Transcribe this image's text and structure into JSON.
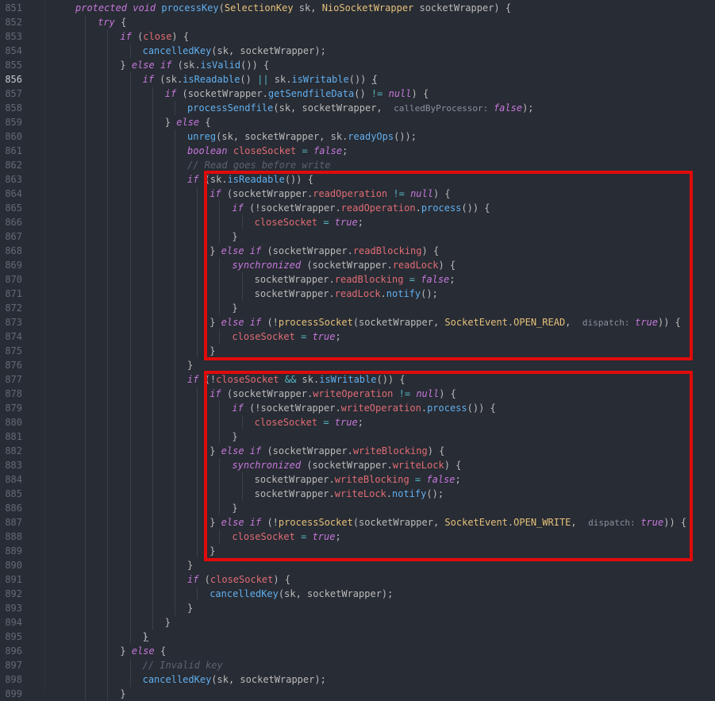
{
  "editor": {
    "current_line": "856",
    "highlights": [
      "if-readable-block",
      "if-writable-block"
    ],
    "colors": {
      "background": "#282c34",
      "highlight_box": "#e00b0b"
    },
    "lines": [
      {
        "n": "851",
        "indent": 4,
        "t": [
          [
            "kw",
            "protected void "
          ],
          [
            "fn",
            "processKey"
          ],
          [
            "txt",
            "("
          ],
          [
            "type",
            "SelectionKey"
          ],
          [
            "txt",
            " sk, "
          ],
          [
            "type",
            "NioSocketWrapper"
          ],
          [
            "txt",
            " socketWrapper) {"
          ]
        ]
      },
      {
        "n": "852",
        "indent": 5,
        "t": [
          [
            "kw",
            "try"
          ],
          [
            "txt",
            " {"
          ]
        ]
      },
      {
        "n": "853",
        "indent": 6,
        "t": [
          [
            "kw",
            "if"
          ],
          [
            "txt",
            " ("
          ],
          [
            "var",
            "close"
          ],
          [
            "txt",
            ") {"
          ]
        ]
      },
      {
        "n": "854",
        "indent": 7,
        "t": [
          [
            "fn",
            "cancelledKey"
          ],
          [
            "txt",
            "(sk, socketWrapper);"
          ]
        ]
      },
      {
        "n": "855",
        "indent": 6,
        "t": [
          [
            "txt",
            "} "
          ],
          [
            "kw",
            "else if"
          ],
          [
            "txt",
            " (sk."
          ],
          [
            "fn",
            "isValid"
          ],
          [
            "txt",
            "()) {"
          ]
        ]
      },
      {
        "n": "856",
        "indent": 7,
        "t": [
          [
            "kw",
            "if"
          ],
          [
            "txt",
            " (sk."
          ],
          [
            "fn",
            "isReadable"
          ],
          [
            "txt",
            "() "
          ],
          [
            "op",
            "||"
          ],
          [
            "txt",
            " sk."
          ],
          [
            "fn",
            "isWritable"
          ],
          [
            "txt",
            "()) "
          ],
          [
            "brace",
            "{"
          ]
        ]
      },
      {
        "n": "857",
        "indent": 8,
        "t": [
          [
            "kw",
            "if"
          ],
          [
            "txt",
            " (socketWrapper."
          ],
          [
            "fn",
            "getSendfileData"
          ],
          [
            "txt",
            "() "
          ],
          [
            "op",
            "!="
          ],
          [
            "txt",
            " "
          ],
          [
            "bool",
            "null"
          ],
          [
            "txt",
            ") {"
          ]
        ]
      },
      {
        "n": "858",
        "indent": 9,
        "t": [
          [
            "fn",
            "processSendfile"
          ],
          [
            "txt",
            "(sk, socketWrapper,  "
          ],
          [
            "hint",
            "calledByProcessor: "
          ],
          [
            "bool",
            "false"
          ],
          [
            "txt",
            ");"
          ]
        ]
      },
      {
        "n": "859",
        "indent": 8,
        "t": [
          [
            "txt",
            "} "
          ],
          [
            "kw",
            "else"
          ],
          [
            "txt",
            " {"
          ]
        ]
      },
      {
        "n": "860",
        "indent": 9,
        "t": [
          [
            "fn",
            "unreg"
          ],
          [
            "txt",
            "(sk, socketWrapper, sk."
          ],
          [
            "fn",
            "readyOps"
          ],
          [
            "txt",
            "());"
          ]
        ]
      },
      {
        "n": "861",
        "indent": 9,
        "t": [
          [
            "kw",
            "boolean"
          ],
          [
            "txt",
            " "
          ],
          [
            "var",
            "closeSocket"
          ],
          [
            "txt",
            " "
          ],
          [
            "op",
            "="
          ],
          [
            "txt",
            " "
          ],
          [
            "bool",
            "false"
          ],
          [
            "txt",
            ";"
          ]
        ]
      },
      {
        "n": "862",
        "indent": 9,
        "t": [
          [
            "cmt",
            "// Read goes before write"
          ]
        ]
      },
      {
        "n": "863",
        "indent": 9,
        "t": [
          [
            "kw",
            "if"
          ],
          [
            "txt",
            " (sk."
          ],
          [
            "fn",
            "isReadable"
          ],
          [
            "txt",
            "()) {"
          ]
        ]
      },
      {
        "n": "864",
        "indent": 10,
        "t": [
          [
            "kw",
            "if"
          ],
          [
            "txt",
            " (socketWrapper."
          ],
          [
            "field",
            "readOperation"
          ],
          [
            "txt",
            " "
          ],
          [
            "op",
            "!="
          ],
          [
            "txt",
            " "
          ],
          [
            "bool",
            "null"
          ],
          [
            "txt",
            ") {"
          ]
        ]
      },
      {
        "n": "865",
        "indent": 11,
        "t": [
          [
            "kw",
            "if"
          ],
          [
            "txt",
            " (!socketWrapper."
          ],
          [
            "field",
            "readOperation"
          ],
          [
            "txt",
            "."
          ],
          [
            "fn",
            "process"
          ],
          [
            "txt",
            "()) {"
          ]
        ]
      },
      {
        "n": "866",
        "indent": 12,
        "t": [
          [
            "var",
            "closeSocket"
          ],
          [
            "txt",
            " "
          ],
          [
            "op",
            "="
          ],
          [
            "txt",
            " "
          ],
          [
            "bool",
            "true"
          ],
          [
            "txt",
            ";"
          ]
        ]
      },
      {
        "n": "867",
        "indent": 11,
        "t": [
          [
            "txt",
            "}"
          ]
        ]
      },
      {
        "n": "868",
        "indent": 10,
        "t": [
          [
            "txt",
            "} "
          ],
          [
            "kw",
            "else if"
          ],
          [
            "txt",
            " (socketWrapper."
          ],
          [
            "field",
            "readBlocking"
          ],
          [
            "txt",
            ") {"
          ]
        ]
      },
      {
        "n": "869",
        "indent": 11,
        "t": [
          [
            "kw",
            "synchronized"
          ],
          [
            "txt",
            " (socketWrapper."
          ],
          [
            "field",
            "readLock"
          ],
          [
            "txt",
            ") {"
          ]
        ]
      },
      {
        "n": "870",
        "indent": 12,
        "t": [
          [
            "txt",
            "socketWrapper."
          ],
          [
            "field",
            "readBlocking"
          ],
          [
            "txt",
            " "
          ],
          [
            "op",
            "="
          ],
          [
            "txt",
            " "
          ],
          [
            "bool",
            "false"
          ],
          [
            "txt",
            ";"
          ]
        ]
      },
      {
        "n": "871",
        "indent": 12,
        "t": [
          [
            "txt",
            "socketWrapper."
          ],
          [
            "field",
            "readLock"
          ],
          [
            "txt",
            "."
          ],
          [
            "fn",
            "notify"
          ],
          [
            "txt",
            "();"
          ]
        ]
      },
      {
        "n": "872",
        "indent": 11,
        "t": [
          [
            "txt",
            "}"
          ]
        ]
      },
      {
        "n": "873",
        "indent": 10,
        "t": [
          [
            "txt",
            "} "
          ],
          [
            "kw",
            "else if"
          ],
          [
            "txt",
            " (!"
          ],
          [
            "type",
            "processSocket"
          ],
          [
            "txt",
            "(socketWrapper, "
          ],
          [
            "type",
            "SocketEvent"
          ],
          [
            "txt",
            "."
          ],
          [
            "const",
            "OPEN_READ"
          ],
          [
            "txt",
            ",  "
          ],
          [
            "hint",
            "dispatch: "
          ],
          [
            "bool",
            "true"
          ],
          [
            "txt",
            ")) {"
          ]
        ]
      },
      {
        "n": "874",
        "indent": 11,
        "t": [
          [
            "var",
            "closeSocket"
          ],
          [
            "txt",
            " "
          ],
          [
            "op",
            "="
          ],
          [
            "txt",
            " "
          ],
          [
            "bool",
            "true"
          ],
          [
            "txt",
            ";"
          ]
        ]
      },
      {
        "n": "875",
        "indent": 10,
        "t": [
          [
            "txt",
            "}"
          ]
        ]
      },
      {
        "n": "876",
        "indent": 9,
        "t": [
          [
            "txt",
            "}"
          ]
        ]
      },
      {
        "n": "877",
        "indent": 9,
        "t": [
          [
            "kw",
            "if"
          ],
          [
            "txt",
            " (!"
          ],
          [
            "var",
            "closeSocket"
          ],
          [
            "txt",
            " "
          ],
          [
            "op",
            "&&"
          ],
          [
            "txt",
            " sk."
          ],
          [
            "fn",
            "isWritable"
          ],
          [
            "txt",
            "()) {"
          ]
        ]
      },
      {
        "n": "878",
        "indent": 10,
        "t": [
          [
            "kw",
            "if"
          ],
          [
            "txt",
            " (socketWrapper."
          ],
          [
            "field",
            "writeOperation"
          ],
          [
            "txt",
            " "
          ],
          [
            "op",
            "!="
          ],
          [
            "txt",
            " "
          ],
          [
            "bool",
            "null"
          ],
          [
            "txt",
            ") {"
          ]
        ]
      },
      {
        "n": "879",
        "indent": 11,
        "t": [
          [
            "kw",
            "if"
          ],
          [
            "txt",
            " (!socketWrapper."
          ],
          [
            "field",
            "writeOperation"
          ],
          [
            "txt",
            "."
          ],
          [
            "fn",
            "process"
          ],
          [
            "txt",
            "()) {"
          ]
        ]
      },
      {
        "n": "880",
        "indent": 12,
        "t": [
          [
            "var",
            "closeSocket"
          ],
          [
            "txt",
            " "
          ],
          [
            "op",
            "="
          ],
          [
            "txt",
            " "
          ],
          [
            "bool",
            "true"
          ],
          [
            "txt",
            ";"
          ]
        ]
      },
      {
        "n": "881",
        "indent": 11,
        "t": [
          [
            "txt",
            "}"
          ]
        ]
      },
      {
        "n": "882",
        "indent": 10,
        "t": [
          [
            "txt",
            "} "
          ],
          [
            "kw",
            "else if"
          ],
          [
            "txt",
            " (socketWrapper."
          ],
          [
            "field",
            "writeBlocking"
          ],
          [
            "txt",
            ") {"
          ]
        ]
      },
      {
        "n": "883",
        "indent": 11,
        "t": [
          [
            "kw",
            "synchronized"
          ],
          [
            "txt",
            " (socketWrapper."
          ],
          [
            "field",
            "writeLock"
          ],
          [
            "txt",
            ") {"
          ]
        ]
      },
      {
        "n": "884",
        "indent": 12,
        "t": [
          [
            "txt",
            "socketWrapper."
          ],
          [
            "field",
            "writeBlocking"
          ],
          [
            "txt",
            " "
          ],
          [
            "op",
            "="
          ],
          [
            "txt",
            " "
          ],
          [
            "bool",
            "false"
          ],
          [
            "txt",
            ";"
          ]
        ]
      },
      {
        "n": "885",
        "indent": 12,
        "t": [
          [
            "txt",
            "socketWrapper."
          ],
          [
            "field",
            "writeLock"
          ],
          [
            "txt",
            "."
          ],
          [
            "fn",
            "notify"
          ],
          [
            "txt",
            "();"
          ]
        ]
      },
      {
        "n": "886",
        "indent": 11,
        "t": [
          [
            "txt",
            "}"
          ]
        ]
      },
      {
        "n": "887",
        "indent": 10,
        "t": [
          [
            "txt",
            "} "
          ],
          [
            "kw",
            "else if"
          ],
          [
            "txt",
            " (!"
          ],
          [
            "type",
            "processSocket"
          ],
          [
            "txt",
            "(socketWrapper, "
          ],
          [
            "type",
            "SocketEvent"
          ],
          [
            "txt",
            "."
          ],
          [
            "const",
            "OPEN_WRITE"
          ],
          [
            "txt",
            ",  "
          ],
          [
            "hint",
            "dispatch: "
          ],
          [
            "bool",
            "true"
          ],
          [
            "txt",
            ")) {"
          ]
        ]
      },
      {
        "n": "888",
        "indent": 11,
        "t": [
          [
            "var",
            "closeSocket"
          ],
          [
            "txt",
            " "
          ],
          [
            "op",
            "="
          ],
          [
            "txt",
            " "
          ],
          [
            "bool",
            "true"
          ],
          [
            "txt",
            ";"
          ]
        ]
      },
      {
        "n": "889",
        "indent": 10,
        "t": [
          [
            "txt",
            "}"
          ]
        ]
      },
      {
        "n": "890",
        "indent": 9,
        "t": [
          [
            "txt",
            "}"
          ]
        ]
      },
      {
        "n": "891",
        "indent": 9,
        "t": [
          [
            "kw",
            "if"
          ],
          [
            "txt",
            " ("
          ],
          [
            "var",
            "closeSocket"
          ],
          [
            "txt",
            ") {"
          ]
        ]
      },
      {
        "n": "892",
        "indent": 10,
        "t": [
          [
            "fn",
            "cancelledKey"
          ],
          [
            "txt",
            "(sk, socketWrapper);"
          ]
        ]
      },
      {
        "n": "893",
        "indent": 9,
        "t": [
          [
            "txt",
            "}"
          ]
        ]
      },
      {
        "n": "894",
        "indent": 8,
        "t": [
          [
            "txt",
            "}"
          ]
        ]
      },
      {
        "n": "895",
        "indent": 7,
        "t": [
          [
            "brace",
            "}"
          ]
        ]
      },
      {
        "n": "896",
        "indent": 6,
        "t": [
          [
            "txt",
            "} "
          ],
          [
            "kw",
            "else"
          ],
          [
            "txt",
            " {"
          ]
        ]
      },
      {
        "n": "897",
        "indent": 7,
        "t": [
          [
            "cmt",
            "// Invalid key"
          ]
        ]
      },
      {
        "n": "898",
        "indent": 7,
        "t": [
          [
            "fn",
            "cancelledKey"
          ],
          [
            "txt",
            "(sk, socketWrapper);"
          ]
        ]
      },
      {
        "n": "899",
        "indent": 6,
        "t": [
          [
            "txt",
            "}"
          ]
        ]
      }
    ]
  }
}
